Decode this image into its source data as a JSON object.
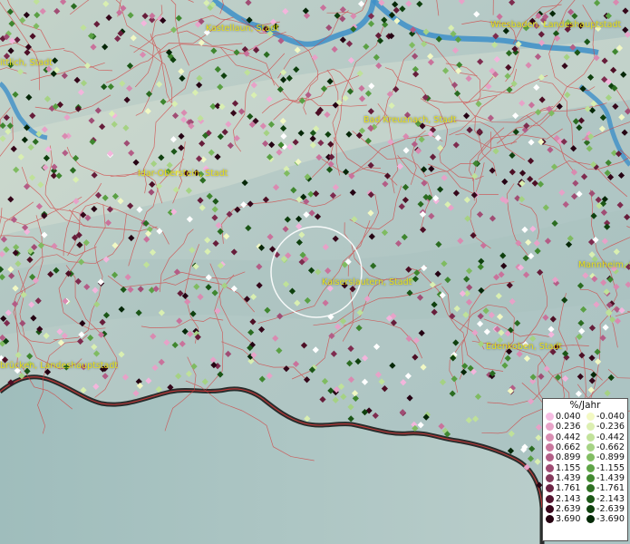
{
  "map": {
    "cities": [
      {
        "id": "kastellaun",
        "label": "Kastellaun, Stadt"
      },
      {
        "id": "wiesbaden",
        "label": "Wiesbaden, Landeshauptstadt"
      },
      {
        "id": "wittlich",
        "label": "ittlich, Stadt"
      },
      {
        "id": "bad-kreuznach",
        "label": "Bad Kreuznach, Stadt"
      },
      {
        "id": "idar-oberstein",
        "label": "Idar-Oberstein, Stadt"
      },
      {
        "id": "mannheim",
        "label": "Mannheim, S"
      },
      {
        "id": "kaiserslautern",
        "label": "Kaiserslautern, Stadt"
      },
      {
        "id": "edenkoben",
        "label": "Edenkoben, Stadt"
      },
      {
        "id": "saarbruecken",
        "label": "brücken, Landeshauptstadt"
      }
    ],
    "point_colors": {
      "pos": [
        "#f3b5dc",
        "#e7a2c8",
        "#d98ab0",
        "#c9729b",
        "#b35d86",
        "#a04d74",
        "#7e2c4f",
        "#661d3a",
        "#4d0f25",
        "#35071a",
        "#250313"
      ],
      "neg": [
        "#f1f8c4",
        "#d9efb1",
        "#bfe199",
        "#a5d283",
        "#7fbb61",
        "#5aa044",
        "#3f862f",
        "#2b6c21",
        "#1b5617",
        "#0f400e",
        "#062708"
      ]
    }
  },
  "legend": {
    "title": "%/Jahr",
    "positive": [
      {
        "value": "0.040",
        "color": "#f6bde3"
      },
      {
        "value": "0.236",
        "color": "#e9a4c9"
      },
      {
        "value": "0.442",
        "color": "#d98eb2"
      },
      {
        "value": "0.662",
        "color": "#c9779d"
      },
      {
        "value": "0.899",
        "color": "#b35f87"
      },
      {
        "value": "1.155",
        "color": "#9f4c73"
      },
      {
        "value": "1.439",
        "color": "#853a5c"
      },
      {
        "value": "1.761",
        "color": "#6b2444"
      },
      {
        "value": "2.143",
        "color": "#531530"
      },
      {
        "value": "2.639",
        "color": "#3a081d"
      },
      {
        "value": "3.690",
        "color": "#260311"
      }
    ],
    "negative": [
      {
        "value": "-0.040",
        "color": "#f3f9c3"
      },
      {
        "value": "-0.236",
        "color": "#dcefb2"
      },
      {
        "value": "-0.442",
        "color": "#c2e29b"
      },
      {
        "value": "-0.662",
        "color": "#a6d385"
      },
      {
        "value": "-0.899",
        "color": "#82bd63"
      },
      {
        "value": "-1.155",
        "color": "#5fa447"
      },
      {
        "value": "-1.439",
        "color": "#438a31"
      },
      {
        "value": "-1.761",
        "color": "#2f7023"
      },
      {
        "value": "-2.143",
        "color": "#1e5918"
      },
      {
        "value": "-2.639",
        "color": "#11430f"
      },
      {
        "value": "-3.690",
        "color": "#062a08"
      }
    ]
  }
}
